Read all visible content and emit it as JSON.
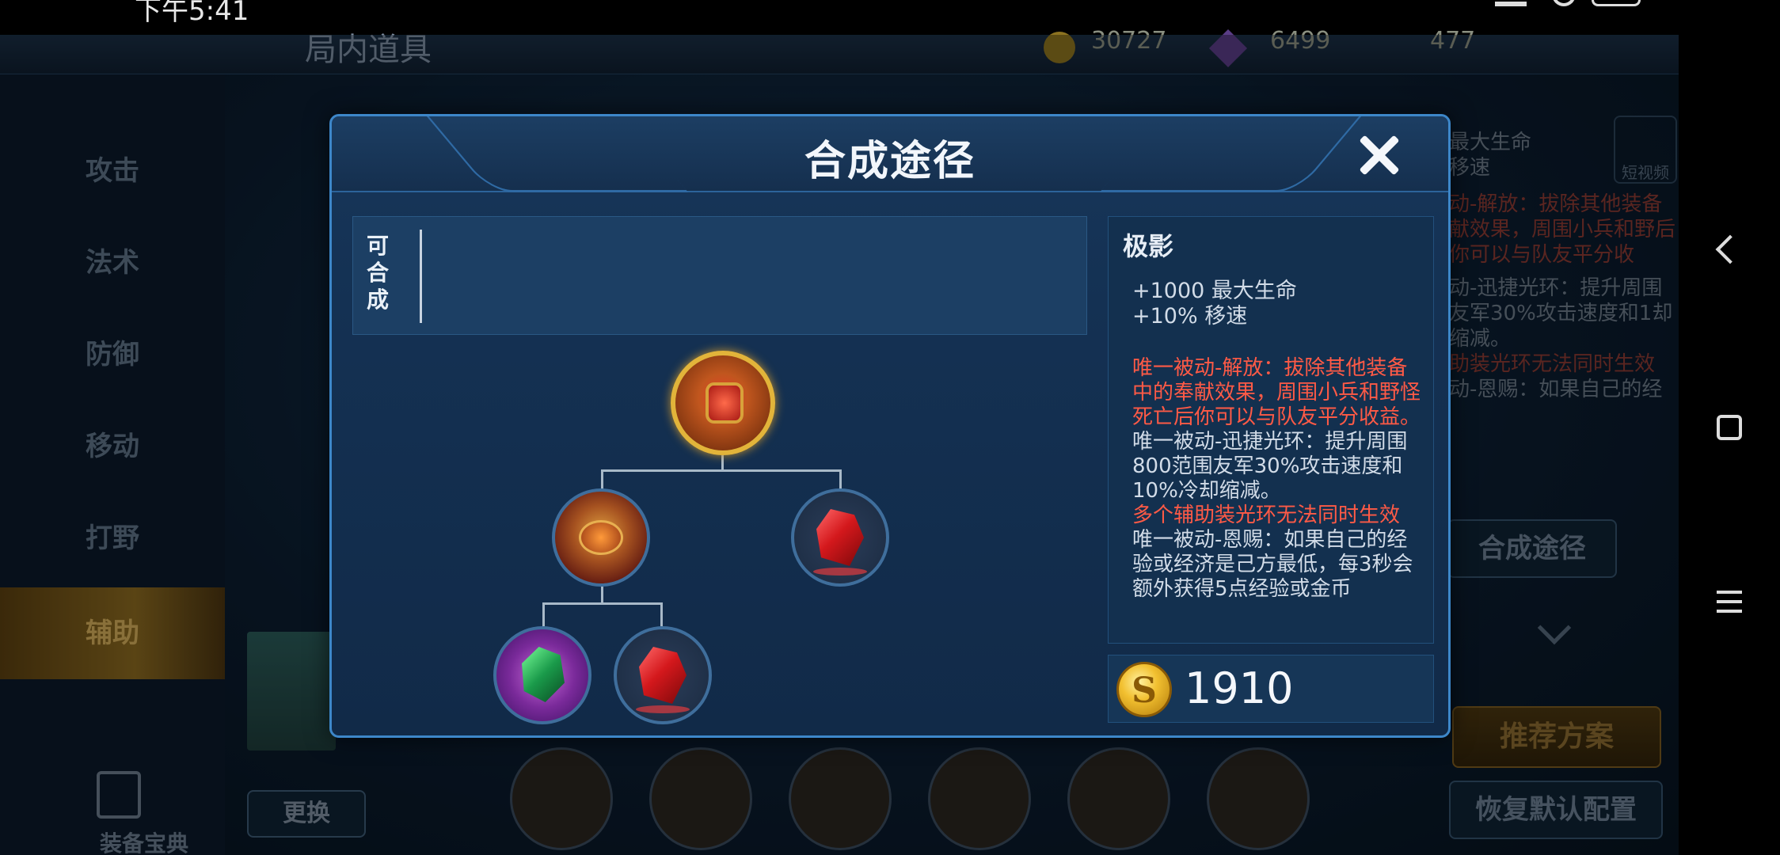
{
  "status_bar": {
    "time": "下午5:41"
  },
  "background": {
    "title": "局内道具",
    "currency": [
      "30727",
      "6499",
      "477"
    ],
    "categories": [
      {
        "label": "攻击",
        "active": false
      },
      {
        "label": "法术",
        "active": false
      },
      {
        "label": "防御",
        "active": false
      },
      {
        "label": "移动",
        "active": false
      },
      {
        "label": "打野",
        "active": false
      },
      {
        "label": "辅助",
        "active": true
      }
    ],
    "codex_label": "装备宝典",
    "swap_label": "更换",
    "video_label": "短视频",
    "side_desc_1": "最大生命",
    "side_desc_2": "移速",
    "side_desc_red_1": "动-解放：拔除其他装备献效果，周围小兵和野后你可以与队友平分收",
    "side_desc_white_1": "动-迅捷光环：提升周围友军30%攻击速度和1却缩减。",
    "side_desc_red_2": "助装光环无法同时生效",
    "side_desc_white_2": "动-恩赐：如果自己的经",
    "craft_path_button": "合成途径",
    "recommend_button": "推荐方案",
    "restore_button": "恢复默认配置"
  },
  "modal": {
    "title": "合成途径",
    "close_icon": "close-icon",
    "craftable_label": "可合成",
    "tree": {
      "root": {
        "icon": "jiying-item-icon"
      },
      "children": [
        {
          "icon": "red-amulet-item-icon",
          "children": [
            {
              "icon": "green-crystal-item-icon"
            },
            {
              "icon": "ruby-item-icon"
            }
          ]
        },
        {
          "icon": "ruby-item-icon"
        }
      ]
    },
    "item": {
      "name": "极影",
      "stats": [
        "+1000 最大生命",
        "+10% 移速"
      ],
      "passives": [
        {
          "text": "唯一被动-解放：拔除其他装备中的奉献效果，周围小兵和野怪死亡后你可以与队友平分收益。",
          "color": "#ff5a46"
        },
        {
          "text": "唯一被动-迅捷光环：提升周围800范围友军30%攻击速度和10%冷却缩减。",
          "color": "#d2dce8"
        },
        {
          "text": "多个辅助装光环无法同时生效",
          "color": "#ff5a46"
        },
        {
          "text": "唯一被动-恩赐：如果自己的经验或经济是己方最低，每3秒会额外获得5点经验或金币",
          "color": "#d2dce8"
        }
      ],
      "price": "1910"
    }
  }
}
